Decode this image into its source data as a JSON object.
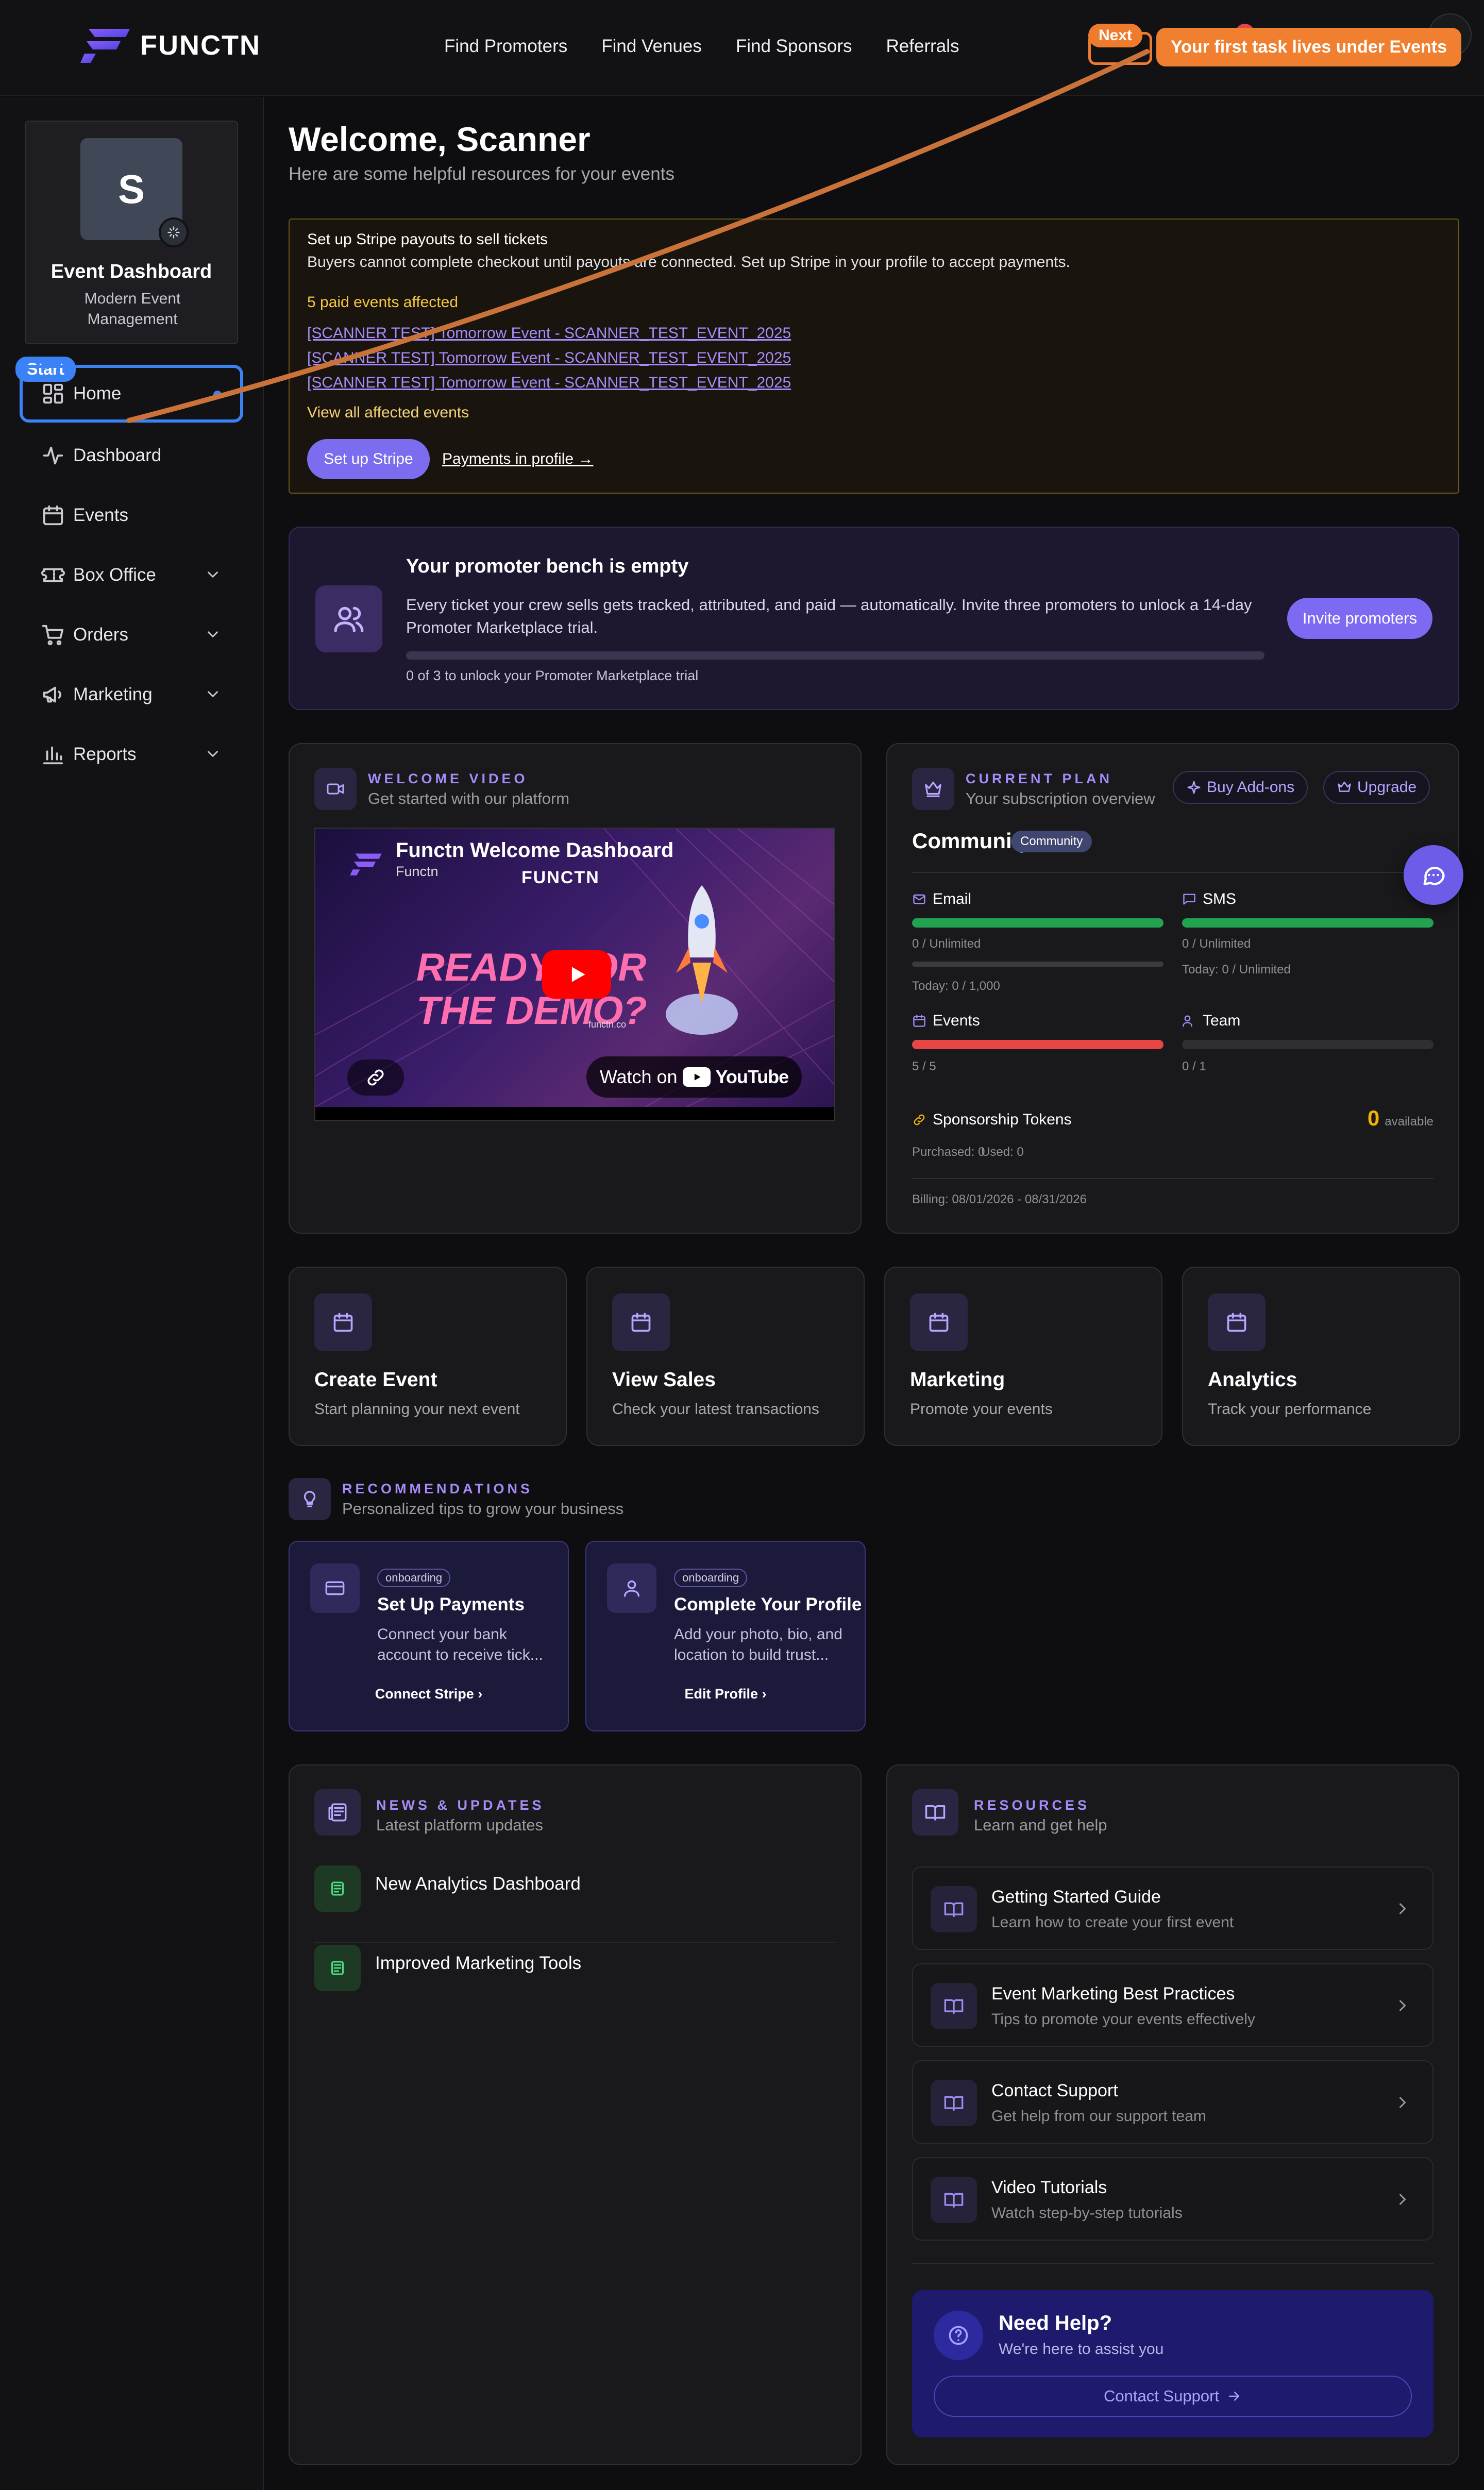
{
  "brand": {
    "name": "FUNCTN"
  },
  "topnav": {
    "links": [
      "Find Promoters",
      "Find Venues",
      "Find Sponsors",
      "Referrals"
    ]
  },
  "tour": {
    "next_label": "Next",
    "tooltip": "Your first task lives under Events",
    "start_label": "Start",
    "accent": "#ef7c2e"
  },
  "sidebar": {
    "profile": {
      "initial": "S",
      "title": "Event Dashboard",
      "subtitle": "Modern Event Management"
    },
    "items": [
      {
        "label": "Home",
        "icon": "grid-icon"
      },
      {
        "label": "Dashboard",
        "icon": "activity-icon"
      },
      {
        "label": "Events",
        "icon": "calendar-icon"
      },
      {
        "label": "Box Office",
        "icon": "ticket-icon"
      },
      {
        "label": "Orders",
        "icon": "cart-icon"
      },
      {
        "label": "Marketing",
        "icon": "megaphone-icon"
      },
      {
        "label": "Reports",
        "icon": "bar-chart-icon"
      }
    ]
  },
  "welcome": {
    "title": "Welcome, Scanner",
    "subtitle": "Here are some helpful resources for your events"
  },
  "stripe_alert": {
    "title": "Set up Stripe payouts to sell tickets",
    "desc": "Buyers cannot complete checkout until payouts are connected. Set up Stripe in your profile to accept payments.",
    "count": "5 paid events affected",
    "events": [
      "[SCANNER TEST] Tomorrow Event - SCANNER_TEST_EVENT_2025",
      "[SCANNER TEST] Tomorrow Event - SCANNER_TEST_EVENT_2025",
      "[SCANNER TEST] Tomorrow Event - SCANNER_TEST_EVENT_2025"
    ],
    "view_all": "View all affected events",
    "button": "Set up Stripe",
    "link": "Payments in profile →"
  },
  "bench": {
    "title": "Your promoter bench is empty",
    "desc": "Every ticket your crew sells gets tracked, attributed, and paid — automatically. Invite three promoters to unlock a 14-day Promoter Marketplace trial.",
    "progress_text": "0 of 3 to unlock your Promoter Marketplace trial",
    "progress": 0,
    "button": "Invite promoters"
  },
  "video": {
    "caps": "WELCOME VIDEO",
    "sub": "Get started with our platform",
    "title": "Functn Welcome Dashboard",
    "channel": "Functn",
    "overlay_brand": "FUNCTN",
    "headline": "READY FOR THE DEMO?",
    "url": "functn.co",
    "watch": "Watch on",
    "yt": "YouTube"
  },
  "plan": {
    "caps": "CURRENT PLAN",
    "sub": "Your subscription overview",
    "buy": "Buy Add-ons",
    "upgrade": "Upgrade",
    "name": "Community",
    "badge": "Community",
    "email": {
      "label": "Email",
      "value": "0 / Unlimited",
      "today": "Today: 0 / 1,000",
      "fill": 1.0,
      "today_fill": 0
    },
    "sms": {
      "label": "SMS",
      "value": "0 / Unlimited",
      "today": "Today: 0 / Unlimited",
      "fill": 1.0
    },
    "events": {
      "label": "Events",
      "value": "5 / 5",
      "fill": 1.0
    },
    "team": {
      "label": "Team",
      "value": "0 / 1",
      "fill": 0
    },
    "tokens": {
      "label": "Sponsorship Tokens",
      "count": "0",
      "available": "available",
      "purchased": "Purchased: 0",
      "used": "Used: 0"
    },
    "billing": "Billing: 08/01/2026 - 08/31/2026",
    "colors": {
      "green": "#22a352",
      "red": "#e84545",
      "gold": "#f5b400"
    }
  },
  "quick_actions": [
    {
      "title": "Create Event",
      "desc": "Start planning your next event"
    },
    {
      "title": "View Sales",
      "desc": "Check your latest transactions"
    },
    {
      "title": "Marketing",
      "desc": "Promote your events"
    },
    {
      "title": "Analytics",
      "desc": "Track your performance"
    }
  ],
  "recommendations": {
    "caps": "RECOMMENDATIONS",
    "sub": "Personalized tips to grow your business",
    "items": [
      {
        "tag": "onboarding",
        "title": "Set Up Payments",
        "desc": "Connect your bank account to receive tick...",
        "action": "Connect Stripe"
      },
      {
        "tag": "onboarding",
        "title": "Complete Your Profile",
        "desc": "Add your photo, bio, and location to build trust...",
        "action": "Edit Profile"
      }
    ]
  },
  "news": {
    "caps": "NEWS & UPDATES",
    "sub": "Latest platform updates",
    "items": [
      "New Analytics Dashboard",
      "Improved Marketing Tools"
    ]
  },
  "resources": {
    "caps": "RESOURCES",
    "sub": "Learn and get help",
    "items": [
      {
        "title": "Getting Started Guide",
        "desc": "Learn how to create your first event"
      },
      {
        "title": "Event Marketing Best Practices",
        "desc": "Tips to promote your events effectively"
      },
      {
        "title": "Contact Support",
        "desc": "Get help from our support team"
      },
      {
        "title": "Video Tutorials",
        "desc": "Watch step-by-step tutorials"
      }
    ],
    "help": {
      "title": "Need Help?",
      "desc": "We're here to assist you",
      "button": "Contact Support"
    }
  },
  "accent": "#7c6cf0"
}
